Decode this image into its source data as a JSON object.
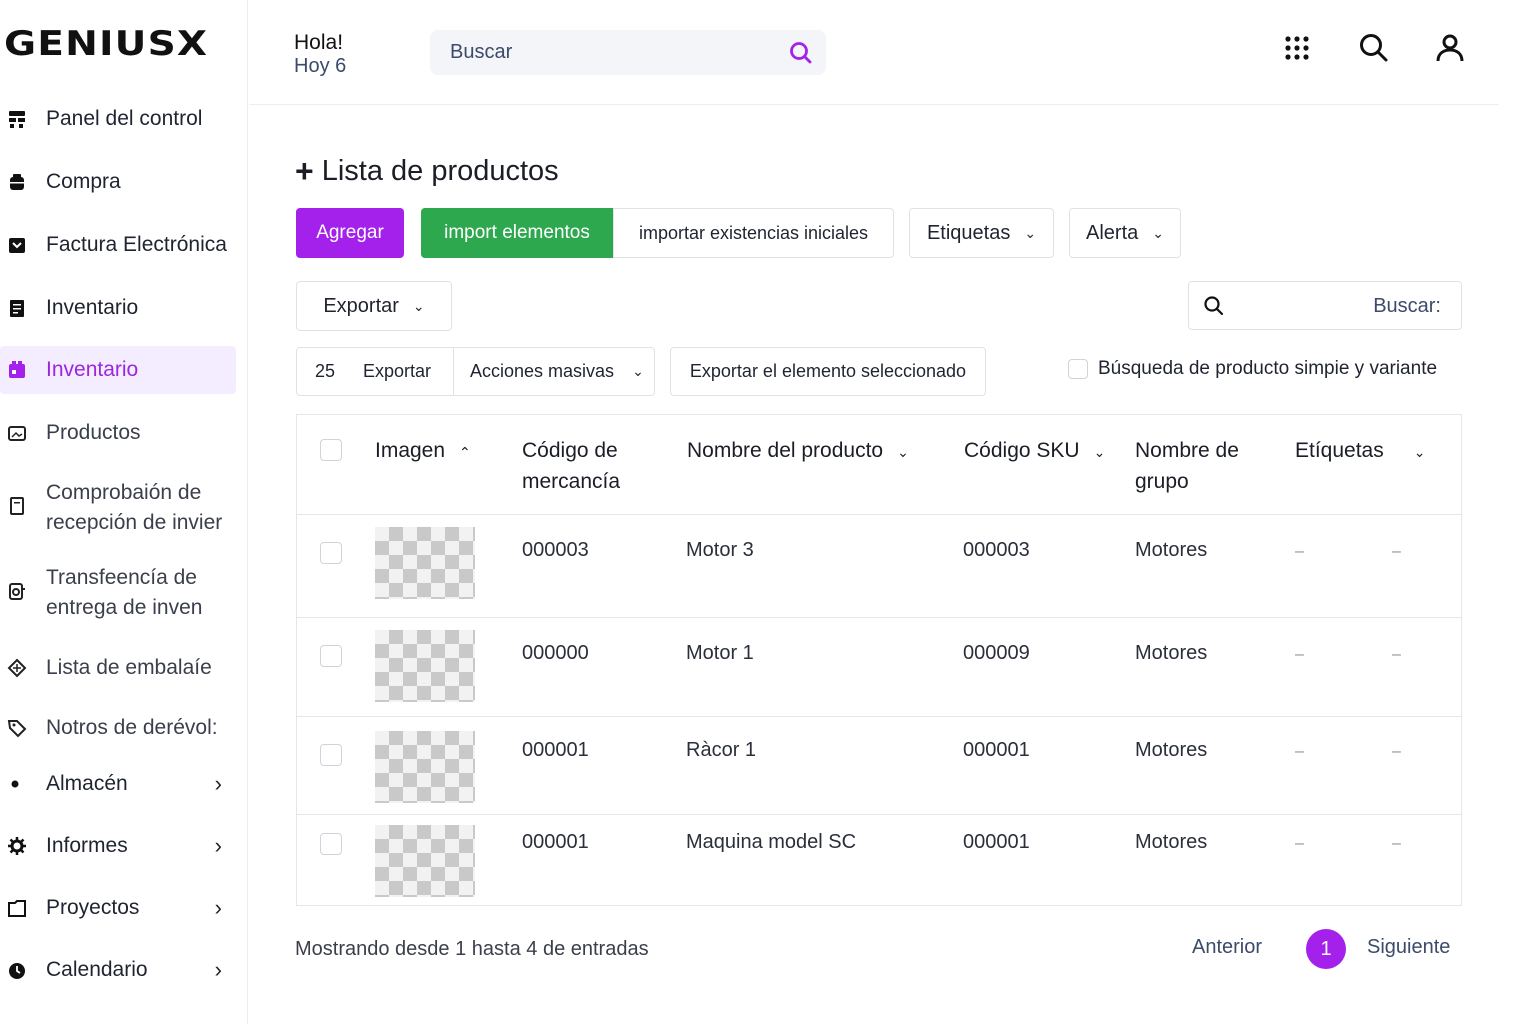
{
  "app": {
    "logo": "GENIUSX"
  },
  "header": {
    "greeting": "Hola!",
    "today": "Hoy 6",
    "search_placeholder": "Buscar"
  },
  "sidebar": {
    "items": [
      {
        "label": "Panel del control",
        "icon": "dashboard-icon"
      },
      {
        "label": "Compra",
        "icon": "cart-icon"
      },
      {
        "label": "Factura Electrónica",
        "icon": "invoice-icon"
      },
      {
        "label": "Inventario",
        "icon": "inventory-icon"
      },
      {
        "label": "Inventario",
        "icon": "inventory-box-icon",
        "active": true
      },
      {
        "label": "Productos",
        "icon": "image-icon"
      },
      {
        "label": "Comprobaión de recepción de invier",
        "icon": "document-icon"
      },
      {
        "label": "Transfeencía de entrega de inven",
        "icon": "transfer-icon"
      },
      {
        "label": "Lista de embalaíe",
        "icon": "package-icon"
      },
      {
        "label": "Notros de derévol:",
        "icon": "tag-icon"
      },
      {
        "label": "Almacén",
        "icon": "dot-icon",
        "chevron": true
      },
      {
        "label": "Informes",
        "icon": "gear-icon",
        "chevron": true
      },
      {
        "label": "Proyectos",
        "icon": "folder-icon",
        "chevron": true
      },
      {
        "label": "Calendario",
        "icon": "clock-icon",
        "chevron": true
      }
    ]
  },
  "main": {
    "title": "Lista de productos",
    "buttons": {
      "add": "Agregar",
      "import": "import elementos",
      "import_stock": "importar existencias iniciales",
      "tags": "Etiquetas",
      "alert": "Alerta",
      "export": "Exportar",
      "page_size": "25",
      "export_small": "Exportar",
      "mass_actions": "Acciones masivas",
      "export_selected": "Exportar el elemento seleccionado"
    },
    "table_search_placeholder": "Buscar:",
    "simple_search_label": "Búsqueda de producto simpie y variante",
    "table": {
      "headers": [
        "Imagen",
        "Código de mercancía",
        "Nombre del producto",
        "Código SKU",
        "Nombre de grupo",
        "Etíquetas"
      ],
      "rows": [
        {
          "code": "000003",
          "name": "Motor 3",
          "sku": "000003",
          "group": "Motores",
          "tag1": "–",
          "tag2": "–"
        },
        {
          "code": "000000",
          "name": "Motor 1",
          "sku": "000009",
          "group": "Motores",
          "tag1": "–",
          "tag2": "–"
        },
        {
          "code": "000001",
          "name": "Ràcor 1",
          "sku": "000001",
          "group": "Motores",
          "tag1": "–",
          "tag2": "–"
        },
        {
          "code": "000001",
          "name": "Maquina model SC",
          "sku": "000001",
          "group": "Motores",
          "tag1": "–",
          "tag2": "–"
        }
      ]
    },
    "footer": {
      "info": "Mostrando desde 1 hasta 4 de entradas",
      "prev": "Anterior",
      "page": "1",
      "next": "Siguiente"
    }
  },
  "colors": {
    "accent": "#a321ea",
    "success": "#2ea84f"
  }
}
